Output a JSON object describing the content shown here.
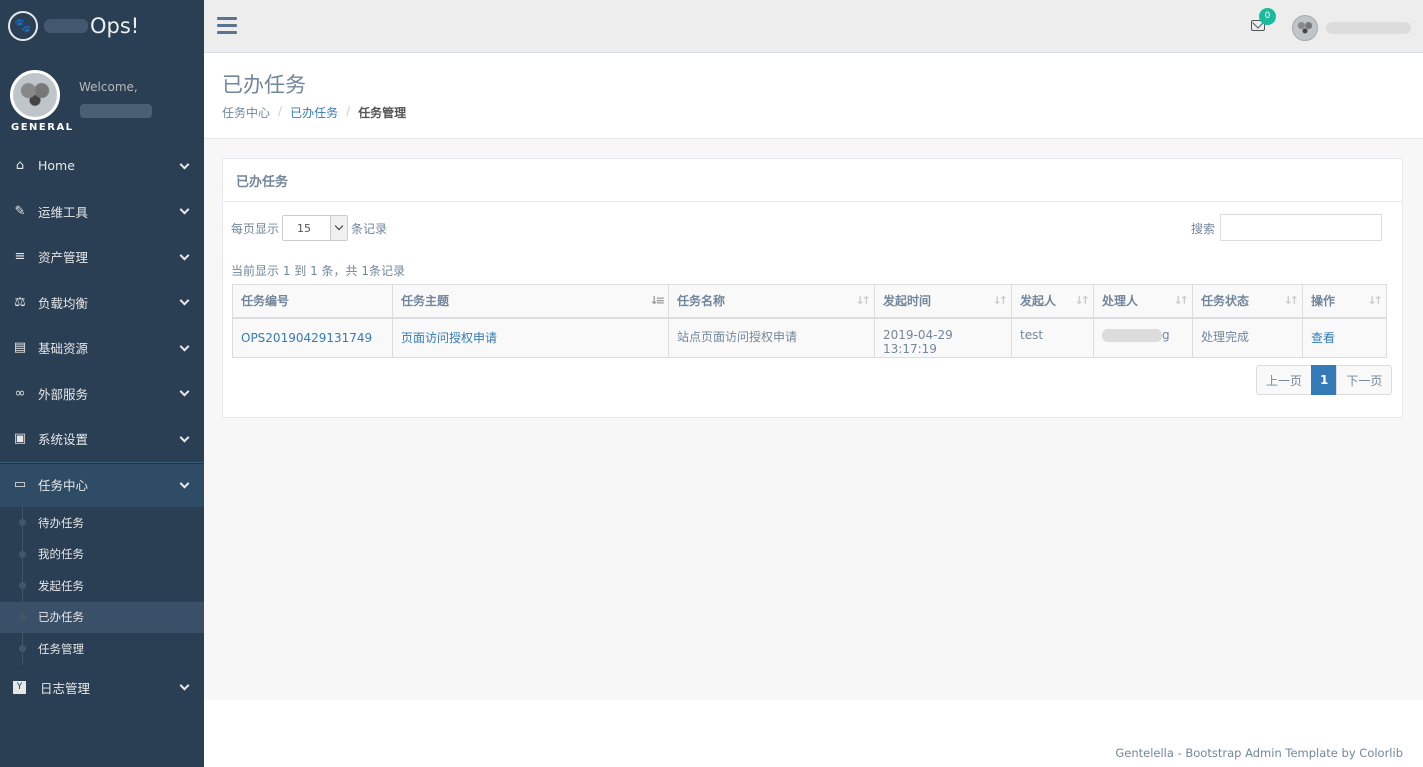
{
  "brand": {
    "title": "Ops!",
    "logo_icon": "paw-icon"
  },
  "profile": {
    "welcome": "Welcome,",
    "section": "GENERAL"
  },
  "sidebar": {
    "items": [
      {
        "label": "Home",
        "icon": "⌂"
      },
      {
        "label": "运维工具",
        "icon": "✎"
      },
      {
        "label": "资产管理",
        "icon": "≡"
      },
      {
        "label": "负载均衡",
        "icon": "⚖"
      },
      {
        "label": "基础资源",
        "icon": "▤"
      },
      {
        "label": "外部服务",
        "icon": "∞"
      },
      {
        "label": "系统设置",
        "icon": "▣"
      },
      {
        "label": "任务中心",
        "icon": "▭"
      },
      {
        "label": "日志管理",
        "icon": "Y"
      }
    ],
    "task_submenu": [
      "待办任务",
      "我的任务",
      "发起任务",
      "已办任务",
      "任务管理"
    ]
  },
  "topnav": {
    "mail_count": "0"
  },
  "page": {
    "title": "已办任务",
    "breadcrumb": [
      "任务中心",
      "已办任务",
      "任务管理"
    ]
  },
  "panel": {
    "title": "已办任务",
    "length_label": "每页显示",
    "length_value": "15",
    "length_suffix": "条记录",
    "search_label": "搜索",
    "info": "当前显示 1 到 1 条，共 1条记录"
  },
  "table": {
    "headers": [
      "任务编号",
      "任务主题",
      "任务名称",
      "发起时间",
      "发起人",
      "处理人",
      "任务状态",
      "操作"
    ],
    "rows": [
      {
        "id": "OPS20190429131749",
        "subject": "页面访问授权申请",
        "name": "站点页面访问授权申请",
        "time": "2019-04-29 13:17:19",
        "initiator": "test",
        "handler_suffix": "g",
        "status": "处理完成",
        "action": "查看"
      }
    ]
  },
  "pager": {
    "prev": "上一页",
    "current": "1",
    "next": "下一页"
  },
  "footer": {
    "text": "Gentelella - Bootstrap Admin Template by Colorlib"
  },
  "colors": {
    "sidebar": "#2a3f54",
    "accent": "#337ab7",
    "badge": "#1abb9c"
  }
}
